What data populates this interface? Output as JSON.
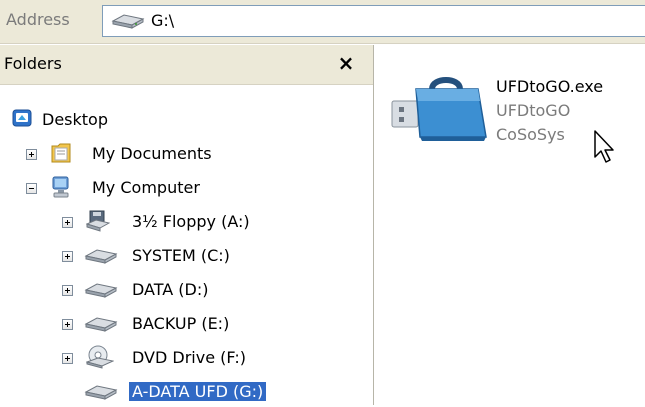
{
  "address": {
    "label": "Address",
    "value": "G:\\",
    "icon": "drive-icon"
  },
  "folders": {
    "title": "Folders",
    "close_label": "×",
    "items": [
      {
        "label": "Desktop",
        "icon": "desktop-icon"
      },
      {
        "label": "My Documents",
        "icon": "my-documents-icon",
        "expander": "+"
      },
      {
        "label": "My Computer",
        "icon": "my-computer-icon",
        "expander": "-"
      },
      {
        "label": "3½ Floppy (A:)",
        "icon": "floppy-drive-icon",
        "expander": "+"
      },
      {
        "label": "SYSTEM (C:)",
        "icon": "drive-icon",
        "expander": "+"
      },
      {
        "label": "DATA (D:)",
        "icon": "drive-icon",
        "expander": "+"
      },
      {
        "label": "BACKUP (E:)",
        "icon": "drive-icon",
        "expander": "+"
      },
      {
        "label": "DVD Drive (F:)",
        "icon": "dvd-drive-icon",
        "expander": "+"
      },
      {
        "label": "A-DATA UFD (G:)",
        "icon": "drive-icon",
        "selected": true
      }
    ]
  },
  "content": {
    "file": {
      "name": "UFDtoGO.exe",
      "description": "UFDtoGO",
      "company": "CoSoSys",
      "icon": "ufdtogo-app-icon"
    }
  },
  "colors": {
    "toolbar_bg": "#ece9d8",
    "selection": "#316ac5",
    "muted_text": "#7b7b7b"
  }
}
